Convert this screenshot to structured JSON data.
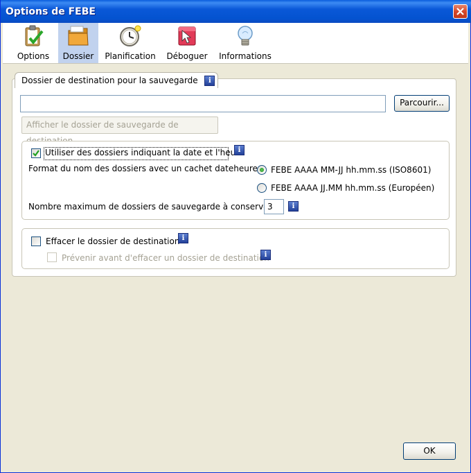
{
  "window": {
    "title": "Options de FEBE"
  },
  "tabs": [
    {
      "label": "Options",
      "icon": "clipboard-check-icon"
    },
    {
      "label": "Dossier",
      "icon": "folder-icon",
      "active": true
    },
    {
      "label": "Planification",
      "icon": "clock-icon"
    },
    {
      "label": "Déboguer",
      "icon": "debug-arrow-icon"
    },
    {
      "label": "Informations",
      "icon": "lightbulb-icon"
    }
  ],
  "destination": {
    "legend": "Dossier de destination pour la sauvegarde",
    "path_value": "",
    "browse_label": "Parcourir...",
    "show_folder_label": "Afficher le dossier de sauvegarde de destination"
  },
  "dated": {
    "checkbox_label": "Utiliser des dossiers indiquant la date et l'heure",
    "checked": true,
    "format_label": "Format du nom des dossiers avec un cachet dateheure :",
    "option_iso": "FEBE AAAA MM-JJ hh.mm.ss (ISO8601)",
    "option_eu": "FEBE AAAA JJ.MM hh.mm.ss (Européen)",
    "selected": "iso",
    "max_label": "Nombre maximum de dossiers de sauvegarde à conserver :",
    "max_value": "3"
  },
  "erase": {
    "checkbox_label": "Effacer le dossier de destination",
    "checked": false,
    "warn_label": "Prévenir avant d'effacer un dossier de destination",
    "warn_checked": false
  },
  "footer": {
    "ok_label": "OK"
  },
  "colors": {
    "titlebar": "#0a58d8",
    "dialog_bg": "#ece9d8",
    "active_tab": "#c1d2ee",
    "info_icon": "#23419a"
  }
}
